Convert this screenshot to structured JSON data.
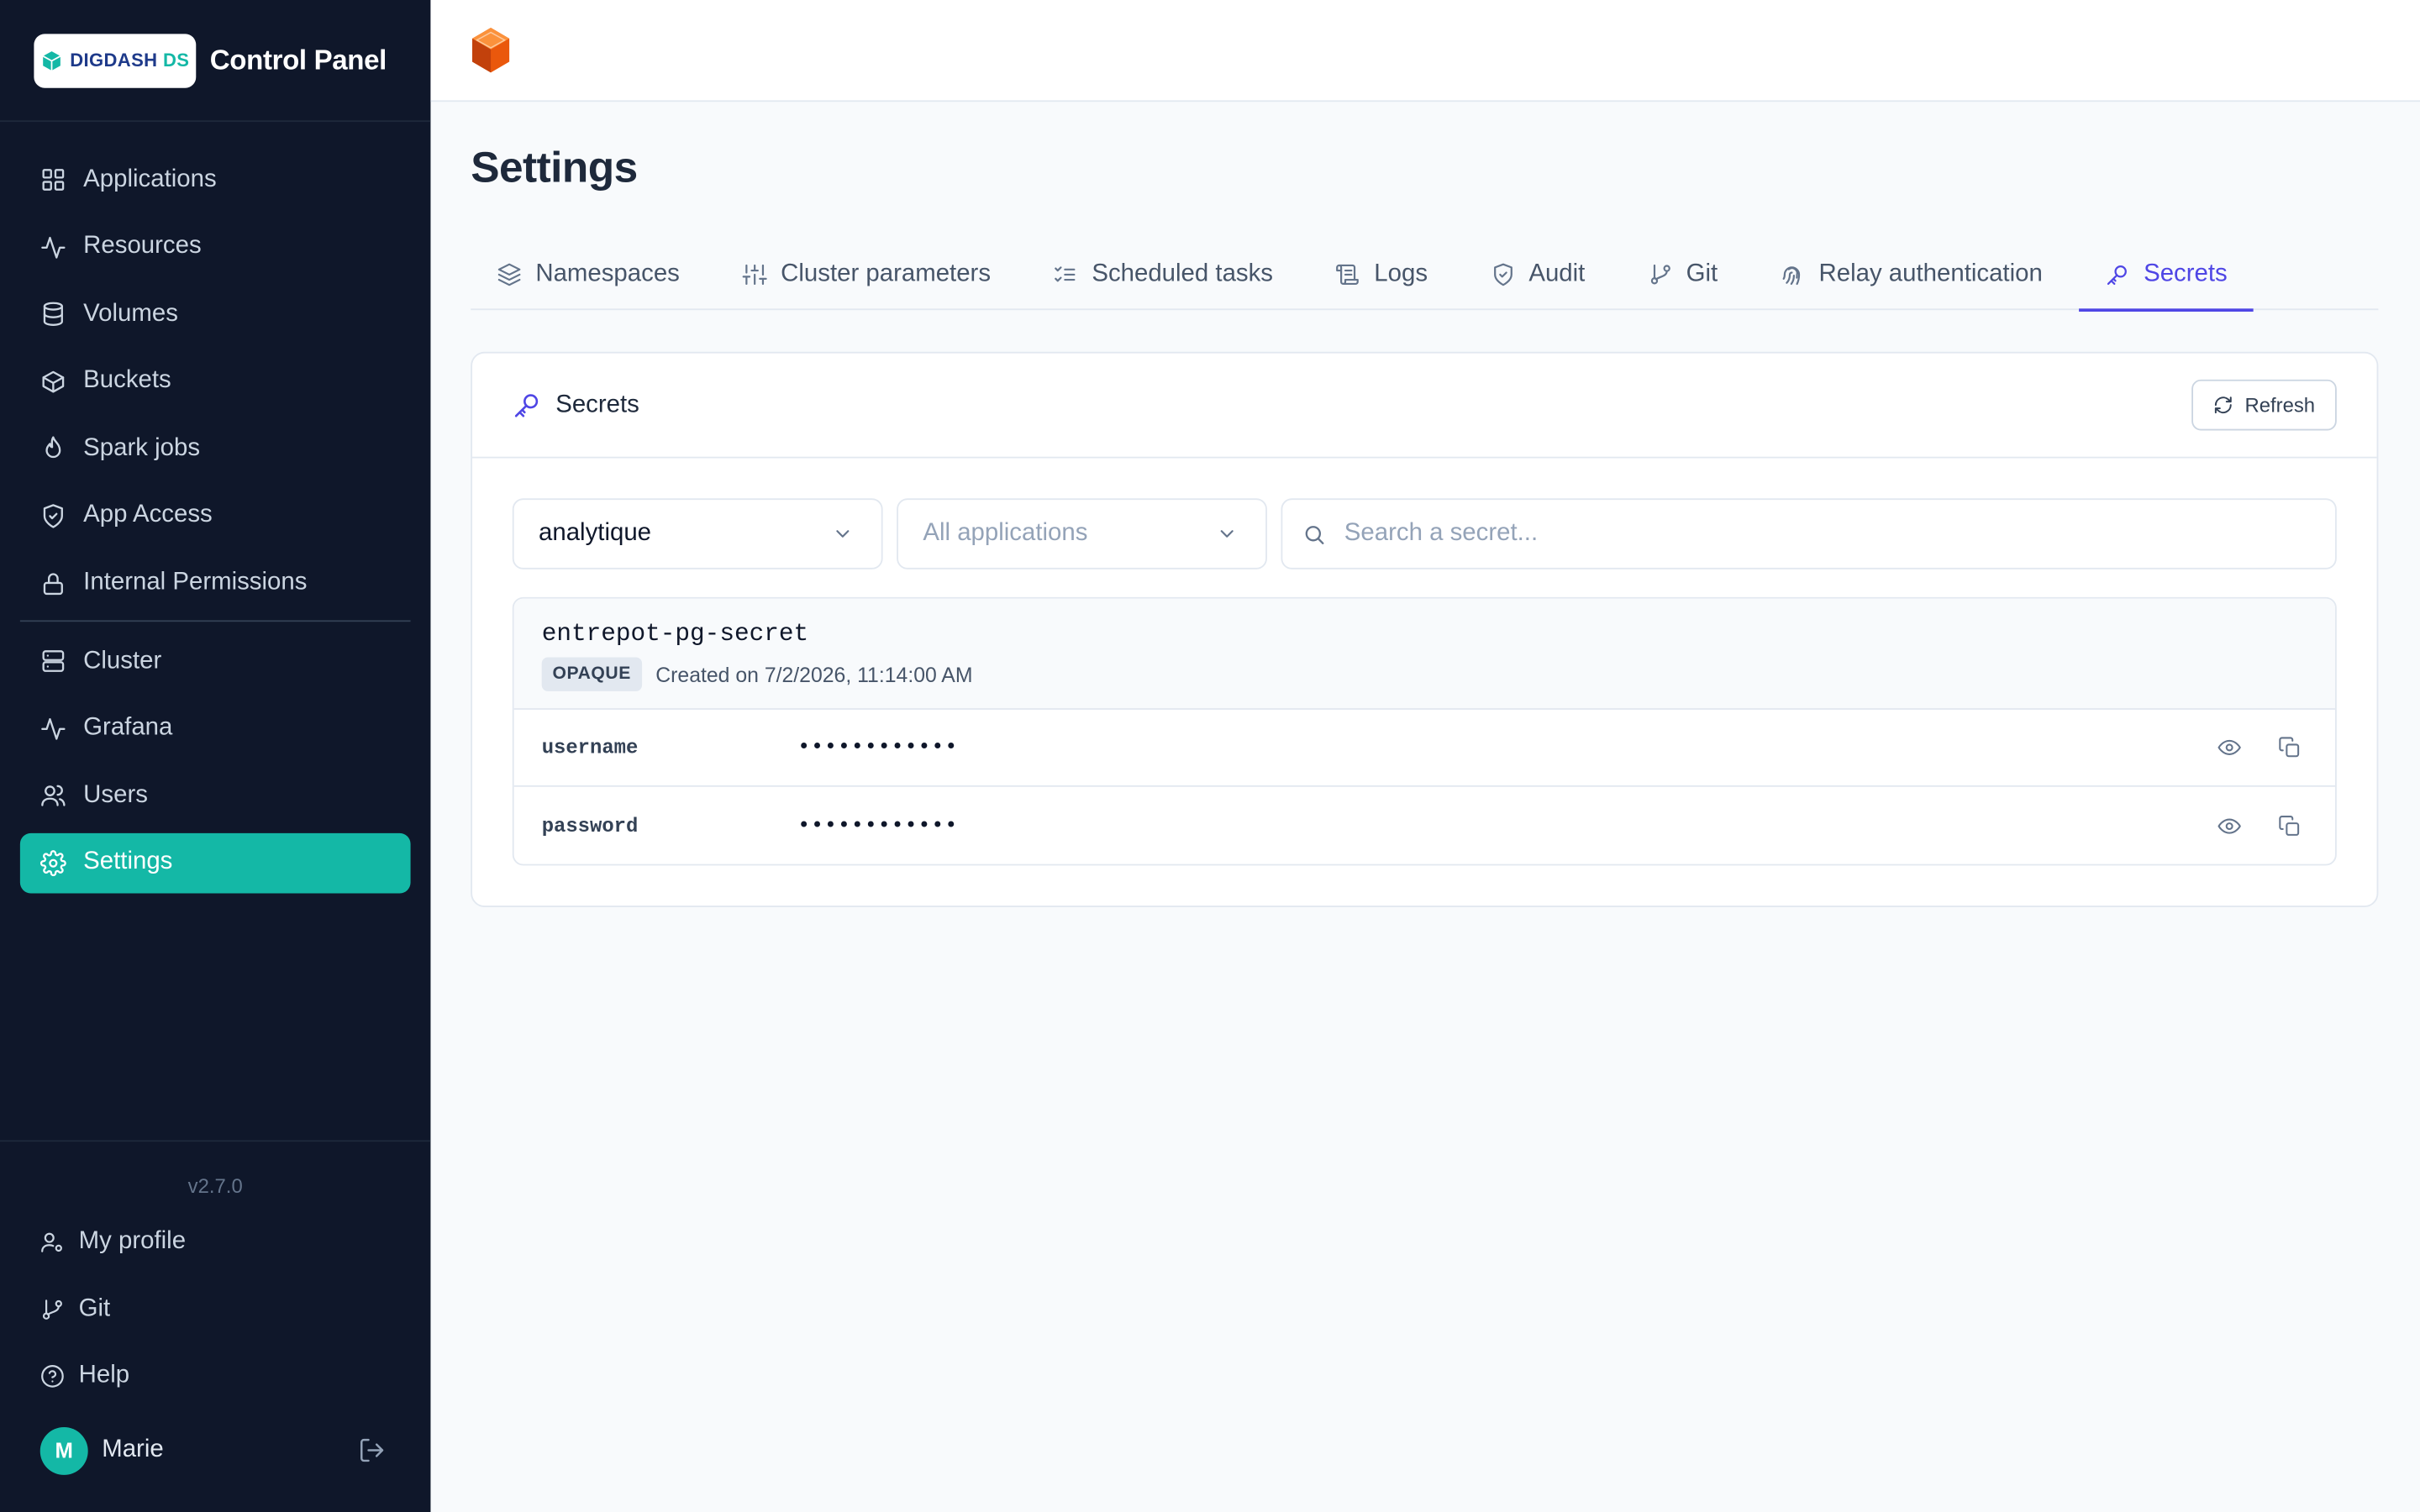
{
  "brand": {
    "logo_text_a": "DIGDASH",
    "logo_text_b": " DS",
    "title": "Control Panel"
  },
  "sidebar": {
    "items": [
      {
        "label": "Applications",
        "icon": "grid-icon"
      },
      {
        "label": "Resources",
        "icon": "activity-icon"
      },
      {
        "label": "Volumes",
        "icon": "database-icon"
      },
      {
        "label": "Buckets",
        "icon": "box-icon"
      },
      {
        "label": "Spark jobs",
        "icon": "flame-icon"
      },
      {
        "label": "App Access",
        "icon": "shield-icon"
      },
      {
        "label": "Internal Permissions",
        "icon": "lock-icon"
      }
    ],
    "items2": [
      {
        "label": "Cluster",
        "icon": "server-icon"
      },
      {
        "label": "Grafana",
        "icon": "activity-icon"
      },
      {
        "label": "Users",
        "icon": "users-icon"
      },
      {
        "label": "Settings",
        "icon": "gear-icon",
        "active": true
      }
    ],
    "version": "v2.7.0",
    "footer": [
      {
        "label": "My profile",
        "icon": "user-gear-icon"
      },
      {
        "label": "Git",
        "icon": "git-branch-icon"
      },
      {
        "label": "Help",
        "icon": "help-circle-icon"
      }
    ],
    "user": {
      "initial": "M",
      "name": "Marie"
    }
  },
  "page": {
    "title": "Settings"
  },
  "tabs": [
    {
      "label": "Namespaces",
      "icon": "layers-icon"
    },
    {
      "label": "Cluster parameters",
      "icon": "sliders-icon"
    },
    {
      "label": "Scheduled tasks",
      "icon": "list-checks-icon"
    },
    {
      "label": "Logs",
      "icon": "scroll-icon"
    },
    {
      "label": "Audit",
      "icon": "shield-check-icon"
    },
    {
      "label": "Git",
      "icon": "git-branch-icon"
    },
    {
      "label": "Relay authentication",
      "icon": "fingerprint-icon"
    },
    {
      "label": "Secrets",
      "icon": "key-icon",
      "active": true
    }
  ],
  "card": {
    "title": "Secrets",
    "refresh_label": "Refresh",
    "namespace_select": "analytique",
    "app_select_placeholder": "All applications",
    "search_placeholder": "Search a secret..."
  },
  "secret": {
    "name": "entrepot-pg-secret",
    "type_badge": "OPAQUE",
    "created": "Created on 7/2/2026, 11:14:00 AM",
    "entries": [
      {
        "key": "username",
        "masked": "••••••••••••"
      },
      {
        "key": "password",
        "masked": "••••••••••••"
      }
    ]
  },
  "colors": {
    "sidebar_bg": "#0f172a",
    "accent_teal": "#14b8a6",
    "accent_indigo": "#4f46e5",
    "brand_orange": "#ea580c"
  }
}
